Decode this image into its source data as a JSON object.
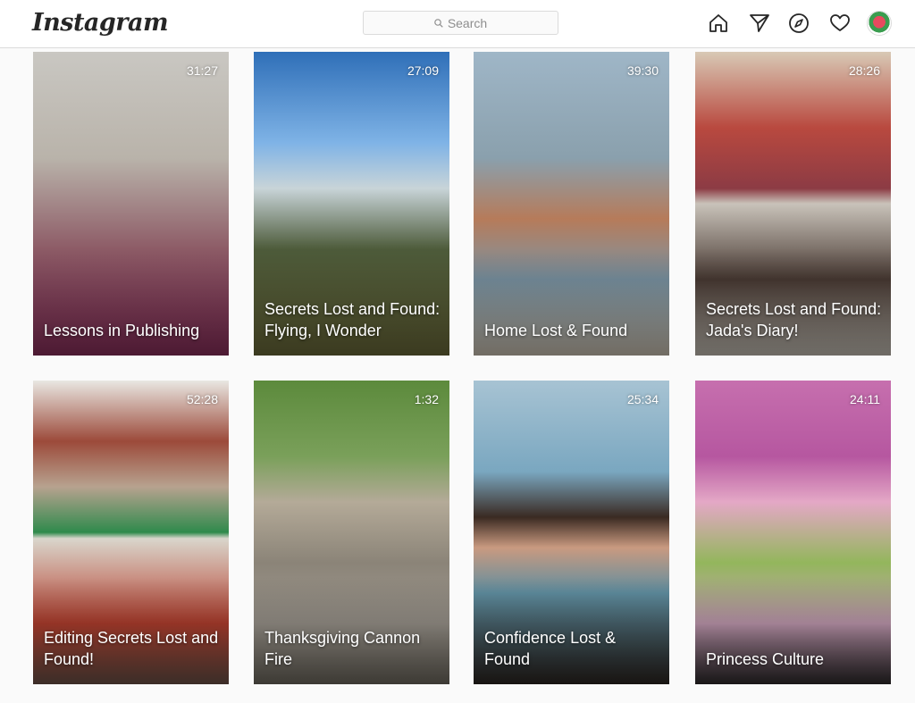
{
  "header": {
    "logo": "Instagram",
    "search_placeholder": "Search"
  },
  "nav_icons": [
    "home-icon",
    "direct-icon",
    "explore-icon",
    "activity-heart-icon",
    "profile-avatar"
  ],
  "videos": [
    {
      "title": "Lessons in Publishing",
      "duration": "31:27"
    },
    {
      "title": "Secrets Lost and Found: Flying, I Wonder",
      "duration": "27:09"
    },
    {
      "title": "Home Lost & Found",
      "duration": "39:30"
    },
    {
      "title": "Secrets Lost and Found: Jada's Diary!",
      "duration": "28:26"
    },
    {
      "title": "Editing Secrets Lost and Found!",
      "duration": "52:28"
    },
    {
      "title": "Thanksgiving Cannon Fire",
      "duration": "1:32"
    },
    {
      "title": "Confidence Lost & Found",
      "duration": "25:34"
    },
    {
      "title": "Princess Culture",
      "duration": "24:11"
    }
  ],
  "colors": {
    "text": "#262626",
    "muted": "#8e8e8e",
    "border": "#dbdbdb",
    "bg": "#fafafa"
  }
}
